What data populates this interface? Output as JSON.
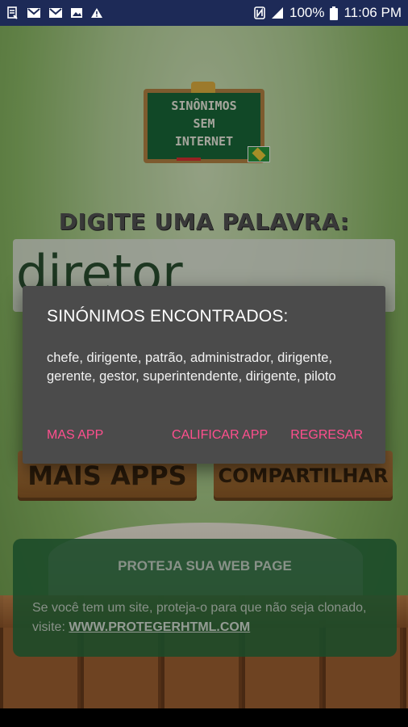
{
  "status_bar": {
    "battery": "100%",
    "time": "11:06 PM",
    "left_icons": [
      "document-scan-icon",
      "gmail-icon",
      "gmail-icon",
      "photo-icon",
      "warning-icon"
    ],
    "right_icons": [
      "nfc-icon",
      "signal-icon",
      "battery-icon"
    ]
  },
  "app": {
    "logo_lines": [
      "SINÔNIMOS",
      "SEM",
      "INTERNET"
    ],
    "prompt_title": "DIGITE UMA PALAVRA:",
    "input_value": "diretor",
    "sign_left": "MAIS APPS",
    "sign_right": "COMPARTILHAR",
    "ad": {
      "title": "PROTEJA SUA WEB PAGE",
      "text": "Se você tem um site, proteja-o para que não seja clonado, visite: ",
      "link": "WWW.PROTEGERHTML.COM"
    }
  },
  "dialog": {
    "title": "SINÓNIMOS ENCONTRADOS:",
    "body": "chefe, dirigente, patrão, administrador, dirigente, gerente, gestor, superintendente, dirigente, piloto",
    "buttons": {
      "mas_app": "MAS APP",
      "calificar_app": "CALIFICAR APP",
      "regresar": "REGRESAR"
    }
  },
  "colors": {
    "status_bar": "#1d2a57",
    "dialog_bg": "#4b4b4b",
    "accent": "#ff4f8e",
    "ad_bg": "#286e3c"
  }
}
